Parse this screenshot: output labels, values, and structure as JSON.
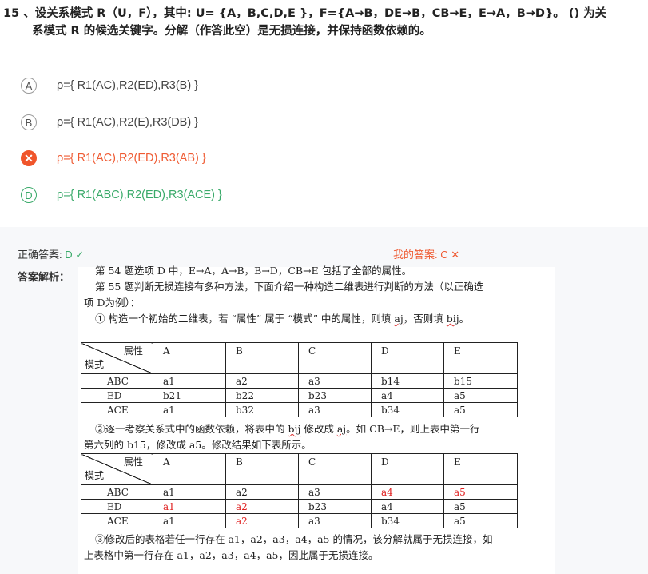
{
  "question": {
    "line1": "15 、设关系模式 R（U，F），其中: U= {A，B,C,D,E }，F={A→B，DE→B，CB→E，E→A，B→D}。 () 为关",
    "line2": "系模式 R 的候选关键字。分解（作答此空）是无损连接，并保持函数依赖的。"
  },
  "options": [
    {
      "badge": "A",
      "text": "ρ={ R1(AC),R2(ED),R3(B) }",
      "state": "normal"
    },
    {
      "badge": "B",
      "text": "ρ={ R1(AC),R2(E),R3(DB) }",
      "state": "normal"
    },
    {
      "badge": "✕",
      "text": "ρ={ R1(AC),R2(ED),R3(AB) }",
      "state": "wrong"
    },
    {
      "badge": "D",
      "text": "ρ={ R1(ABC),R2(ED),R3(ACE) }",
      "state": "correct"
    }
  ],
  "answer": {
    "correct_label": "正确答案:",
    "correct_value": "D ✓",
    "mine_label": "我的答案:",
    "mine_value": "C ✕",
    "analysis_label": "答案解析："
  },
  "explanation": {
    "p1": "第 54 题选项 D 中，E→A，A→B，B→D，CB→E 包括了全部的属性。",
    "p2": "第 55 题判断无损连接有多种方法，下面介绍一种构造二维表进行判断的方法（以正确选",
    "p3": "项 D为例）：",
    "p4a": "① 构造一个初始的二维表，若 “属性” 属于 “模式” 中的属性，则填 ",
    "p4b": "aj",
    "p4c": "，否则填 ",
    "p4d": "bij",
    "p4e": "。",
    "p5a": "②逐一考察关系式中的函数依赖，将表中的 ",
    "p5b": "bij",
    "p5c": " 修改成 ",
    "p5d": "aj",
    "p5e": "。如 CB→E，则上表中第一行",
    "p6": "第六列的 b15，修改成 a5。修改结果如下表所示。",
    "p7": "③修改后的表格若任一行存在 a1，a2，a3，a4，a5 的情况，该分解就属于无损连接，如",
    "p8": "上表格中第一行存在 a1，a2，a3，a4，a5，因此属于无损连接。"
  },
  "table1": {
    "attr_label": "属性",
    "schema_label": "模式",
    "columns": [
      "A",
      "B",
      "C",
      "D",
      "E"
    ],
    "rows": [
      {
        "name": "ABC",
        "cells": [
          "a1",
          "a2",
          "a3",
          "b14",
          "b15"
        ]
      },
      {
        "name": "ED",
        "cells": [
          "b21",
          "b22",
          "b23",
          "a4",
          "a5"
        ]
      },
      {
        "name": "ACE",
        "cells": [
          "a1",
          "b32",
          "a3",
          "b34",
          "a5"
        ]
      }
    ]
  },
  "table2": {
    "attr_label": "属性",
    "schema_label": "模式",
    "columns": [
      "A",
      "B",
      "C",
      "D",
      "E"
    ],
    "rows": [
      {
        "name": "ABC",
        "cells": [
          "a1",
          "a2",
          "a3",
          "a4",
          "a5"
        ],
        "red": [
          false,
          false,
          false,
          true,
          true
        ]
      },
      {
        "name": "ED",
        "cells": [
          "a1",
          "a2",
          "b23",
          "a4",
          "a5"
        ],
        "red": [
          true,
          true,
          false,
          false,
          false
        ]
      },
      {
        "name": "ACE",
        "cells": [
          "a1",
          "a2",
          "a3",
          "b34",
          "a5"
        ],
        "red": [
          false,
          true,
          false,
          false,
          false
        ]
      }
    ]
  },
  "colors": {
    "correct": "#3aaa6a",
    "wrong": "#ef5b33",
    "table_modified": "#e02020"
  }
}
